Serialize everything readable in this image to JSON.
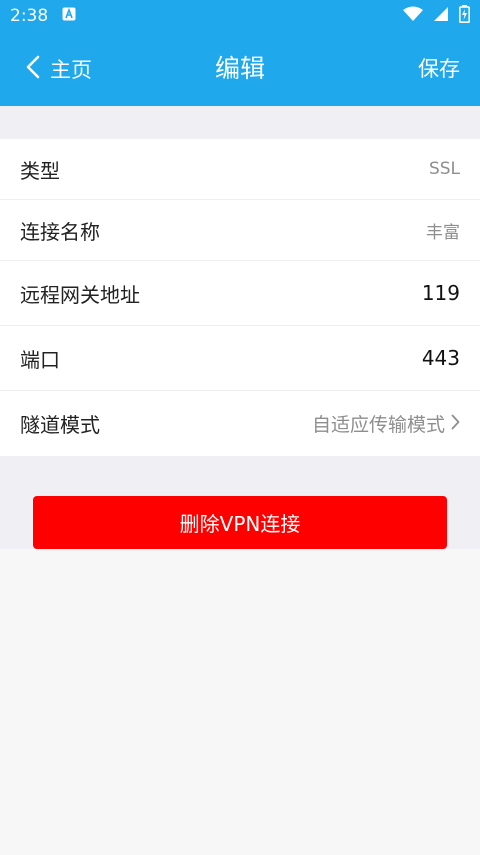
{
  "status_bar": {
    "time": "2:38",
    "notification_icon": "a-badge-icon",
    "icons": [
      "wifi-icon",
      "signal-icon",
      "battery-charging-icon"
    ]
  },
  "app_bar": {
    "back_label": "主页",
    "title": "编辑",
    "save_label": "保存"
  },
  "fields": [
    {
      "label": "类型",
      "value": "SSL"
    },
    {
      "label": "连接名称",
      "value": "丰富"
    },
    {
      "label": "远程网关地址",
      "value": "119"
    },
    {
      "label": "端口",
      "value": "443"
    },
    {
      "label": "隧道模式",
      "value": "自适应传输模式"
    }
  ],
  "delete_button": {
    "label": "删除VPN连接"
  },
  "colors": {
    "header": "#1fa8ec",
    "delete": "#ff0000",
    "section_bg": "#efeff4"
  }
}
